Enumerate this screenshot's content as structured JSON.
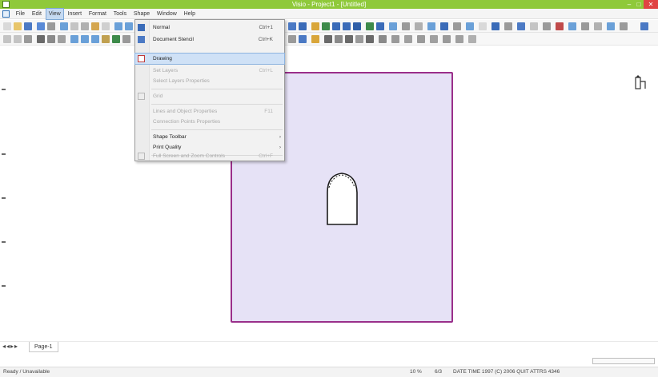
{
  "window": {
    "title": "Visio - Project1 - [Untitled]"
  },
  "menubar": {
    "items": [
      {
        "label": "File"
      },
      {
        "label": "Edit"
      },
      {
        "label": "View"
      },
      {
        "label": "Insert"
      },
      {
        "label": "Format"
      },
      {
        "label": "Tools"
      },
      {
        "label": "Shape"
      },
      {
        "label": "Window"
      },
      {
        "label": "Help"
      }
    ],
    "active_index": 2
  },
  "view_menu": {
    "items": [
      {
        "label": "Normal",
        "shortcut": "Ctrl+1",
        "state": "normal",
        "icon": "normal-view-icon"
      },
      {
        "label": "Document Stencil",
        "shortcut": "Ctrl+K",
        "state": "normal",
        "icon": "stencil-icon"
      },
      {
        "label": "Drawing",
        "shortcut": "",
        "state": "highlight",
        "icon": "drawing-icon"
      },
      {
        "label": "Set Layers",
        "shortcut": "Ctrl+L",
        "state": "disabled",
        "icon": ""
      },
      {
        "label": "Select Layers Properties",
        "shortcut": "",
        "state": "disabled",
        "icon": ""
      },
      {
        "label": "Grid",
        "shortcut": "",
        "state": "disabled",
        "icon": "grid-icon"
      },
      {
        "label": "Lines and Object Properties",
        "shortcut": "F11",
        "state": "disabled",
        "icon": ""
      },
      {
        "label": "Connection Points Properties",
        "shortcut": "",
        "state": "disabled",
        "icon": ""
      },
      {
        "label": "Shape Toolbar",
        "shortcut": "",
        "state": "submenu",
        "icon": ""
      },
      {
        "label": "Print Quality",
        "shortcut": "",
        "state": "submenu",
        "icon": ""
      },
      {
        "label": "Full Screen and Zoom Controls",
        "shortcut": "Ctrl+F",
        "state": "disabled",
        "icon": "fullscreen-icon"
      }
    ]
  },
  "tabs": {
    "nav_arrows": "◂◂▸▸",
    "page_tab": "Page-1"
  },
  "statusbar": {
    "left": "Ready / Unavailable",
    "mid1": "10 %",
    "mid2": "6/3",
    "right": "DATE TIME 1997 (C) 2006 QUIT ATTRS 4346"
  },
  "colors": {
    "titlebar": "#8fc93a",
    "page_fill": "#e6e2f6",
    "page_border": "#9a2f8a",
    "menu_highlight": "#cfe1f6"
  }
}
